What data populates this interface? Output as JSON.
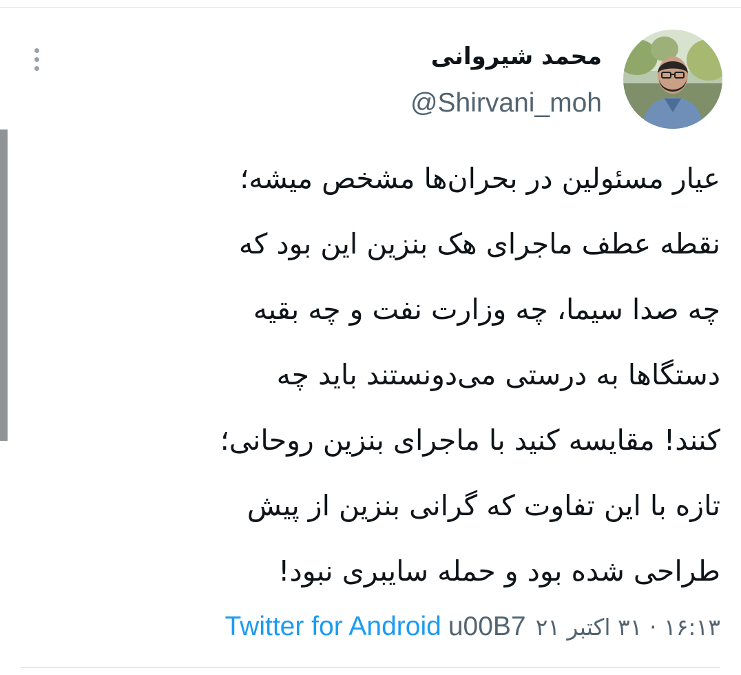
{
  "tweet": {
    "author": {
      "display_name": "محمد شیروانی",
      "handle": "@Shirvani_moh"
    },
    "text_lines": [
      "عیار مسئولین در بحران‌ها مشخص میشه؛",
      "نقطه عطف ماجرای هک بنزین این بود که",
      "چه صدا سیما، چه وزارت نفت و چه بقیه",
      "دستگاها به درستی می‌دونستند باید چه",
      "کنند! مقایسه کنید با ماجرای بنزین روحانی؛",
      "تازه با این تفاوت که گرانی بنزین از پیش",
      "طراحی شده بود و حمله سایبری نبود!"
    ],
    "meta": {
      "timestamp": "۱۶:۱۳ · ۳۱ اکتبر ۲۱",
      "separator": "u00B7",
      "source": "Twitter for Android"
    },
    "more_icon": "more-vertical-icon"
  },
  "colors": {
    "text": "#0f1419",
    "secondary": "#536471",
    "link": "#1d9bf0",
    "divider": "#dfe3e6"
  }
}
